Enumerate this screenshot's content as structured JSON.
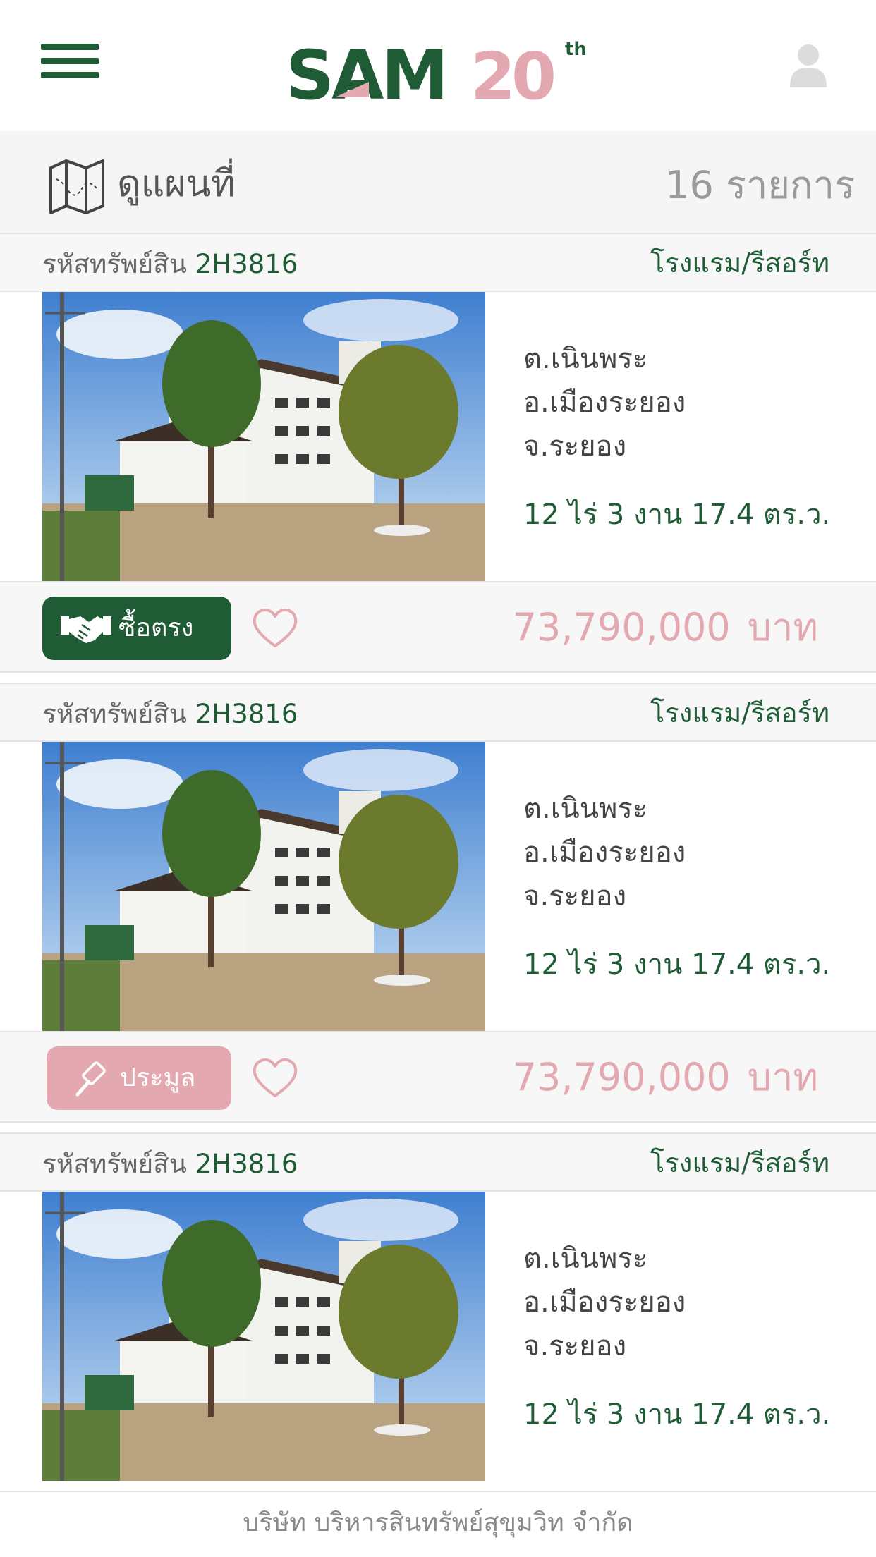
{
  "brand": {
    "logo_text": "SAM",
    "anniversary": "20",
    "anniversary_suffix": "th",
    "colors": {
      "green": "#1f5c36",
      "pink": "#e3a8b0"
    }
  },
  "toolbar": {
    "map_label": "ดูแผนที่",
    "count_label": "16 รายการ"
  },
  "listings": [
    {
      "code_label": "รหัสทรัพย์สิน",
      "code": "2H3816",
      "category": "โรงแรม/รีสอร์ท",
      "subdistrict": "ต.เนินพระ",
      "district": "อ.เมืองระยอง",
      "province": "จ.ระยอง",
      "area": "12 ไร่ 3 งาน 17.4 ตร.ว.",
      "button_label": "ซื้อตรง",
      "button_icon": "handshake-icon",
      "price": "73,790,000",
      "price_unit": "บาท"
    },
    {
      "code_label": "รหัสทรัพย์สิน",
      "code": "2H3816",
      "category": "โรงแรม/รีสอร์ท",
      "subdistrict": "ต.เนินพระ",
      "district": "อ.เมืองระยอง",
      "province": "จ.ระยอง",
      "area": "12 ไร่ 3 งาน 17.4 ตร.ว.",
      "button_label": "ประมูล",
      "button_icon": "gavel-icon",
      "price": "73,790,000",
      "price_unit": "บาท"
    },
    {
      "code_label": "รหัสทรัพย์สิน",
      "code": "2H3816",
      "category": "โรงแรม/รีสอร์ท",
      "subdistrict": "ต.เนินพระ",
      "district": "อ.เมืองระยอง",
      "province": "จ.ระยอง",
      "area": "12 ไร่ 3 งาน 17.4 ตร.ว."
    }
  ],
  "footer": {
    "company": "บริษัท บริหารสินทรัพย์สุขุมวิท จำกัด"
  }
}
